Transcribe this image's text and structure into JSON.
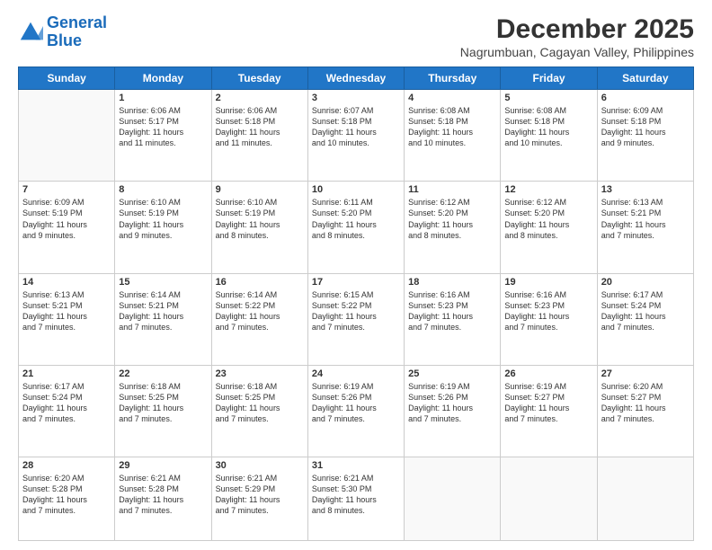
{
  "header": {
    "logo_line1": "General",
    "logo_line2": "Blue",
    "month": "December 2025",
    "location": "Nagrumbuan, Cagayan Valley, Philippines"
  },
  "days_of_week": [
    "Sunday",
    "Monday",
    "Tuesday",
    "Wednesday",
    "Thursday",
    "Friday",
    "Saturday"
  ],
  "weeks": [
    [
      {
        "day": "",
        "info": ""
      },
      {
        "day": "1",
        "info": "Sunrise: 6:06 AM\nSunset: 5:17 PM\nDaylight: 11 hours\nand 11 minutes."
      },
      {
        "day": "2",
        "info": "Sunrise: 6:06 AM\nSunset: 5:18 PM\nDaylight: 11 hours\nand 11 minutes."
      },
      {
        "day": "3",
        "info": "Sunrise: 6:07 AM\nSunset: 5:18 PM\nDaylight: 11 hours\nand 10 minutes."
      },
      {
        "day": "4",
        "info": "Sunrise: 6:08 AM\nSunset: 5:18 PM\nDaylight: 11 hours\nand 10 minutes."
      },
      {
        "day": "5",
        "info": "Sunrise: 6:08 AM\nSunset: 5:18 PM\nDaylight: 11 hours\nand 10 minutes."
      },
      {
        "day": "6",
        "info": "Sunrise: 6:09 AM\nSunset: 5:18 PM\nDaylight: 11 hours\nand 9 minutes."
      }
    ],
    [
      {
        "day": "7",
        "info": "Sunrise: 6:09 AM\nSunset: 5:19 PM\nDaylight: 11 hours\nand 9 minutes."
      },
      {
        "day": "8",
        "info": "Sunrise: 6:10 AM\nSunset: 5:19 PM\nDaylight: 11 hours\nand 9 minutes."
      },
      {
        "day": "9",
        "info": "Sunrise: 6:10 AM\nSunset: 5:19 PM\nDaylight: 11 hours\nand 8 minutes."
      },
      {
        "day": "10",
        "info": "Sunrise: 6:11 AM\nSunset: 5:20 PM\nDaylight: 11 hours\nand 8 minutes."
      },
      {
        "day": "11",
        "info": "Sunrise: 6:12 AM\nSunset: 5:20 PM\nDaylight: 11 hours\nand 8 minutes."
      },
      {
        "day": "12",
        "info": "Sunrise: 6:12 AM\nSunset: 5:20 PM\nDaylight: 11 hours\nand 8 minutes."
      },
      {
        "day": "13",
        "info": "Sunrise: 6:13 AM\nSunset: 5:21 PM\nDaylight: 11 hours\nand 7 minutes."
      }
    ],
    [
      {
        "day": "14",
        "info": "Sunrise: 6:13 AM\nSunset: 5:21 PM\nDaylight: 11 hours\nand 7 minutes."
      },
      {
        "day": "15",
        "info": "Sunrise: 6:14 AM\nSunset: 5:21 PM\nDaylight: 11 hours\nand 7 minutes."
      },
      {
        "day": "16",
        "info": "Sunrise: 6:14 AM\nSunset: 5:22 PM\nDaylight: 11 hours\nand 7 minutes."
      },
      {
        "day": "17",
        "info": "Sunrise: 6:15 AM\nSunset: 5:22 PM\nDaylight: 11 hours\nand 7 minutes."
      },
      {
        "day": "18",
        "info": "Sunrise: 6:16 AM\nSunset: 5:23 PM\nDaylight: 11 hours\nand 7 minutes."
      },
      {
        "day": "19",
        "info": "Sunrise: 6:16 AM\nSunset: 5:23 PM\nDaylight: 11 hours\nand 7 minutes."
      },
      {
        "day": "20",
        "info": "Sunrise: 6:17 AM\nSunset: 5:24 PM\nDaylight: 11 hours\nand 7 minutes."
      }
    ],
    [
      {
        "day": "21",
        "info": "Sunrise: 6:17 AM\nSunset: 5:24 PM\nDaylight: 11 hours\nand 7 minutes."
      },
      {
        "day": "22",
        "info": "Sunrise: 6:18 AM\nSunset: 5:25 PM\nDaylight: 11 hours\nand 7 minutes."
      },
      {
        "day": "23",
        "info": "Sunrise: 6:18 AM\nSunset: 5:25 PM\nDaylight: 11 hours\nand 7 minutes."
      },
      {
        "day": "24",
        "info": "Sunrise: 6:19 AM\nSunset: 5:26 PM\nDaylight: 11 hours\nand 7 minutes."
      },
      {
        "day": "25",
        "info": "Sunrise: 6:19 AM\nSunset: 5:26 PM\nDaylight: 11 hours\nand 7 minutes."
      },
      {
        "day": "26",
        "info": "Sunrise: 6:19 AM\nSunset: 5:27 PM\nDaylight: 11 hours\nand 7 minutes."
      },
      {
        "day": "27",
        "info": "Sunrise: 6:20 AM\nSunset: 5:27 PM\nDaylight: 11 hours\nand 7 minutes."
      }
    ],
    [
      {
        "day": "28",
        "info": "Sunrise: 6:20 AM\nSunset: 5:28 PM\nDaylight: 11 hours\nand 7 minutes."
      },
      {
        "day": "29",
        "info": "Sunrise: 6:21 AM\nSunset: 5:28 PM\nDaylight: 11 hours\nand 7 minutes."
      },
      {
        "day": "30",
        "info": "Sunrise: 6:21 AM\nSunset: 5:29 PM\nDaylight: 11 hours\nand 7 minutes."
      },
      {
        "day": "31",
        "info": "Sunrise: 6:21 AM\nSunset: 5:30 PM\nDaylight: 11 hours\nand 8 minutes."
      },
      {
        "day": "",
        "info": ""
      },
      {
        "day": "",
        "info": ""
      },
      {
        "day": "",
        "info": ""
      }
    ]
  ]
}
